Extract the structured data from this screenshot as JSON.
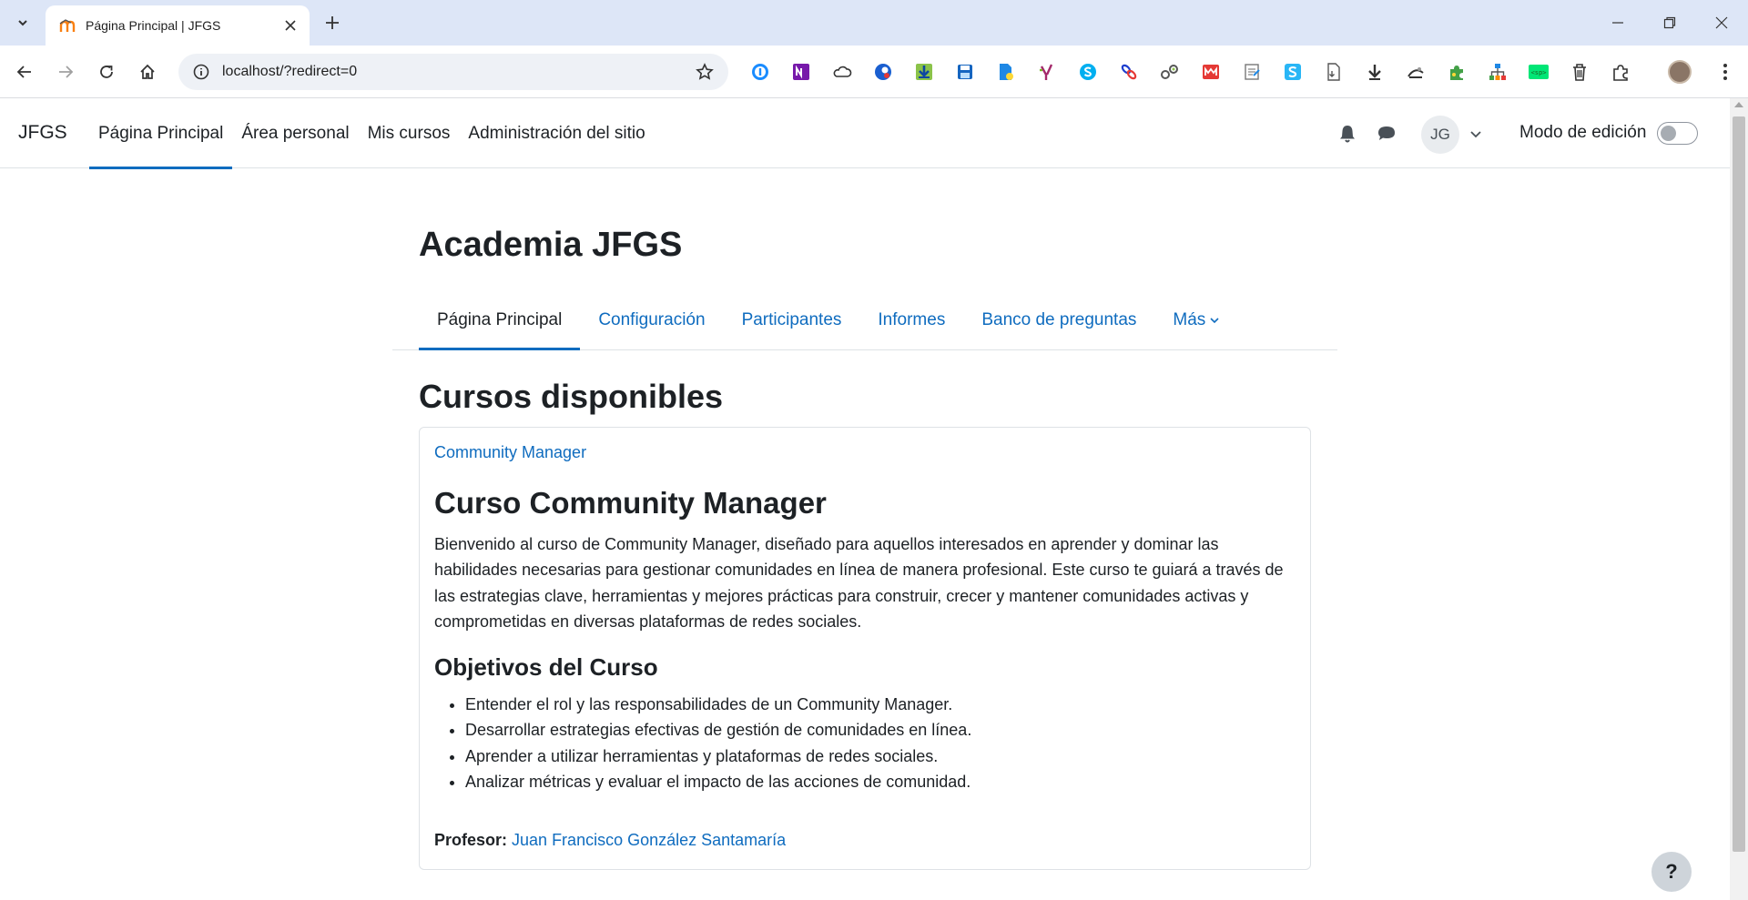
{
  "browser": {
    "tab_title": "Página Principal | JFGS",
    "url": "localhost/?redirect=0",
    "extensions": [
      "1password-icon",
      "onenote-icon",
      "cloud-icon",
      "avast-icon",
      "download-manager-icon",
      "save-icon",
      "docs-icon",
      "yoast-icon",
      "skype-icon",
      "link-icon",
      "share-icon",
      "mendeley-icon",
      "notes-icon",
      "s-icon",
      "pdf-icon",
      "download-icon",
      "hat-icon",
      "puzzle-icon",
      "sitemap-icon",
      "sp-icon",
      "trash-icon",
      "extensions-icon"
    ]
  },
  "navbar": {
    "brand": "JFGS",
    "items": [
      {
        "label": "Página Principal",
        "active": true
      },
      {
        "label": "Área personal",
        "active": false
      },
      {
        "label": "Mis cursos",
        "active": false
      },
      {
        "label": "Administración del sitio",
        "active": false
      }
    ],
    "avatar_initials": "JG",
    "edit_mode_label": "Modo de edición",
    "edit_mode_on": false
  },
  "page": {
    "title": "Academia JFGS",
    "secondary_nav": [
      {
        "label": "Página Principal",
        "active": true
      },
      {
        "label": "Configuración",
        "active": false
      },
      {
        "label": "Participantes",
        "active": false
      },
      {
        "label": "Informes",
        "active": false
      },
      {
        "label": "Banco de preguntas",
        "active": false
      },
      {
        "label": "Más",
        "active": false
      }
    ],
    "section_title": "Cursos disponibles"
  },
  "course": {
    "link": "Community Manager",
    "heading": "Curso Community Manager",
    "description": "Bienvenido al curso de Community Manager, diseñado para aquellos interesados en aprender y dominar las habilidades necesarias para gestionar comunidades en línea de manera profesional. Este curso te guiará a través de las estrategias clave, herramientas y mejores prácticas para construir, crecer y mantener comunidades activas y comprometidas en diversas plataformas de redes sociales.",
    "objectives_heading": "Objetivos del Curso",
    "objectives": [
      "Entender el rol y las responsabilidades de un Community Manager.",
      "Desarrollar estrategias efectivas de gestión de comunidades en línea.",
      "Aprender a utilizar herramientas y plataformas de redes sociales.",
      "Analizar métricas y evaluar el impacto de las acciones de comunidad."
    ],
    "teacher_label": "Profesor:",
    "teacher_name": "Juan Francisco González Santamaría"
  },
  "help_label": "?",
  "colors": {
    "accent": "#0f6cbf",
    "text": "#1d2125",
    "tabstrip": "#dde6f7"
  }
}
